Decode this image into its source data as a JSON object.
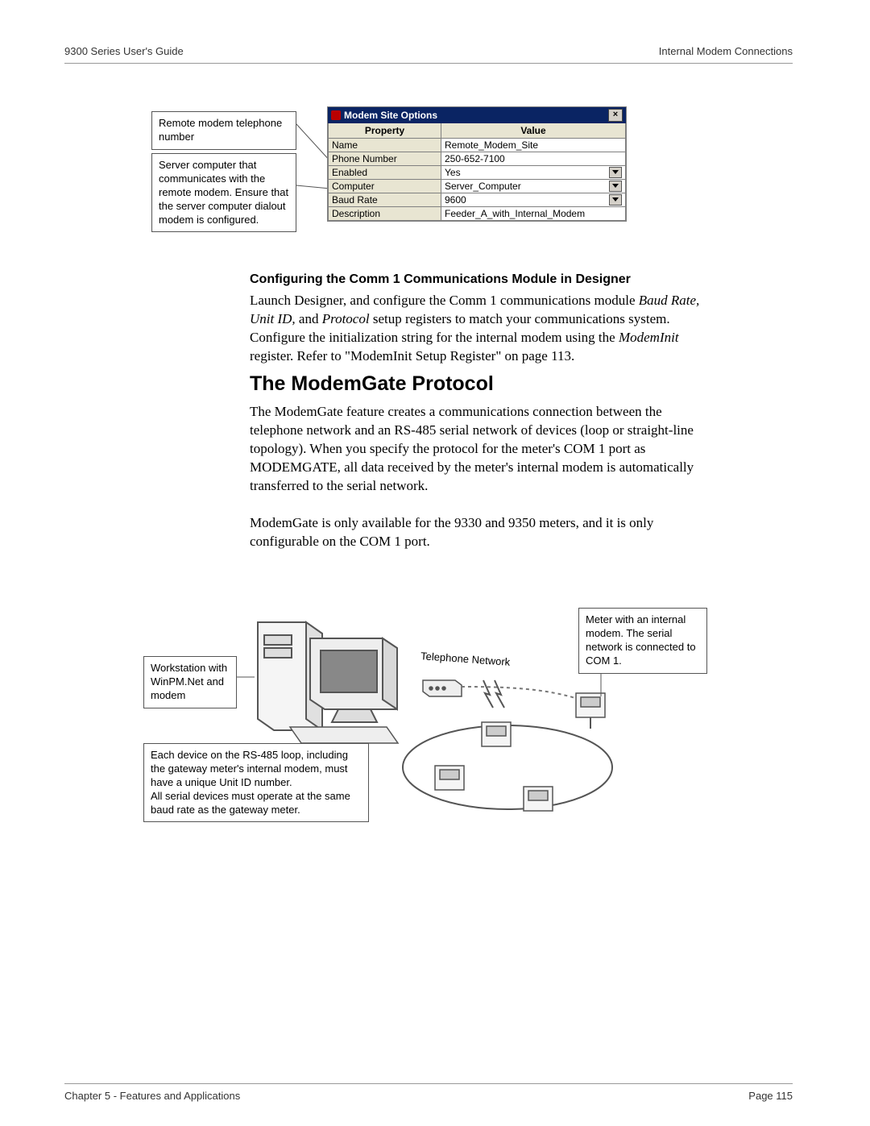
{
  "header": {
    "left": "9300 Series User's Guide",
    "right": "Internal Modem Connections"
  },
  "footer": {
    "left": "Chapter 5 - Features and Applications",
    "right": "Page 115"
  },
  "fig1": {
    "callout1": "Remote modem telephone number",
    "callout2": "Server computer that communicates with the remote modem. Ensure that the server computer dialout modem is configured.",
    "dialog_title": "Modem Site Options",
    "head_prop": "Property",
    "head_val": "Value",
    "rows": [
      {
        "prop": "Name",
        "val": "Remote_Modem_Site",
        "dd": false
      },
      {
        "prop": "Phone Number",
        "val": "250-652-7100",
        "dd": false
      },
      {
        "prop": "Enabled",
        "val": "Yes",
        "dd": true
      },
      {
        "prop": "Computer",
        "val": "Server_Computer",
        "dd": true
      },
      {
        "prop": "Baud Rate",
        "val": "9600",
        "dd": true
      },
      {
        "prop": "Description",
        "val": "Feeder_A_with_Internal_Modem",
        "dd": false
      }
    ]
  },
  "section": {
    "subhead": "Configuring the Comm 1 Communications Module in Designer",
    "p1a": "Launch Designer, and configure the Comm 1 communications module ",
    "p1_it1": "Baud Rate, Unit ID,",
    "p1b": " and ",
    "p1_it2": "Protocol",
    "p1c": " setup registers to match your communications system. Configure the initialization string for the internal modem using the ",
    "p1_it3": "ModemInit",
    "p1d": " register. Refer to \"ModemInit Setup Register\" on page 113.",
    "title": "The ModemGate Protocol",
    "p2a": "The ModemGate feature creates a communications connection between the telephone network and an RS-485 serial network of devices (loop or straight-line topology). When you specify the protocol for the meter's COM 1 port as ",
    "p2_sc": "MODEMGATE",
    "p2b": ", all data received by the meter's internal modem is automatically transferred to the serial network.",
    "p3": "ModemGate is only available for the 9330 and 9350 meters, and it is only configurable on the COM 1 port."
  },
  "fig2": {
    "left_box": "Workstation with WinPM.Net and modem",
    "right_box": "Meter with an internal modem. The serial network is connected to COM 1.",
    "bottom_box_l1": "Each device on the RS-485 loop, including the gateway meter's internal modem, must have a unique Unit ID number.",
    "bottom_box_l2": "All serial devices must operate at the same baud rate as the gateway meter.",
    "net_label": "Telephone Network"
  }
}
